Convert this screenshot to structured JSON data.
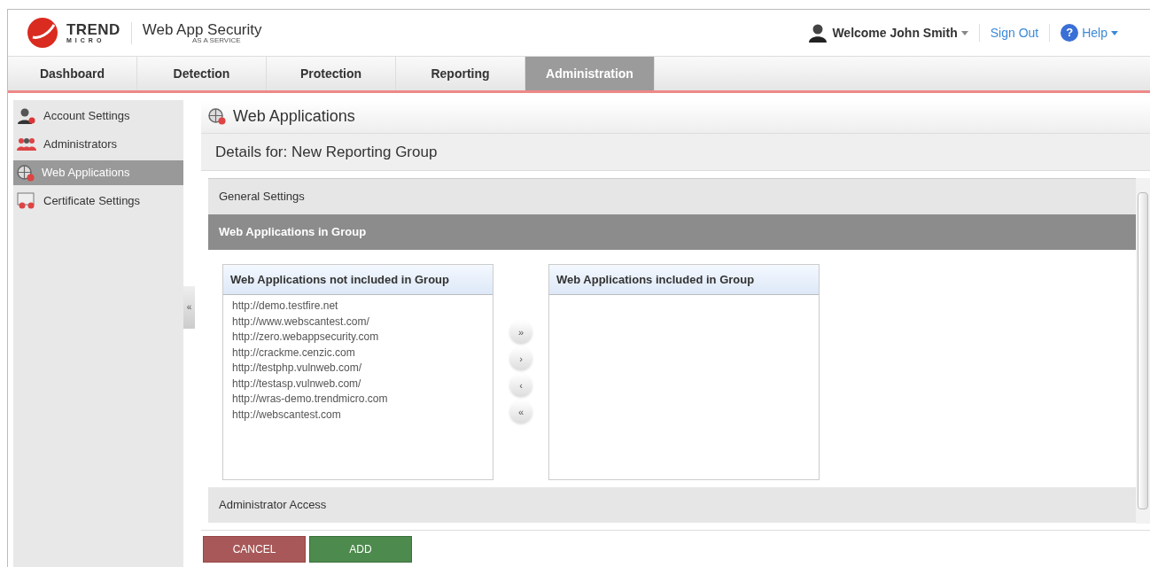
{
  "header": {
    "logo": {
      "word_1": "TREND",
      "word_2": "MICRO"
    },
    "product": "Web App Security",
    "product_sub": "AS A SERVICE",
    "user": "Welcome John Smith",
    "sign_out": "Sign Out",
    "help": "Help",
    "help_icon": "?"
  },
  "tabs": [
    {
      "label": "Dashboard",
      "selected": false
    },
    {
      "label": "Detection",
      "selected": false
    },
    {
      "label": "Protection",
      "selected": false
    },
    {
      "label": "Reporting",
      "selected": false
    },
    {
      "label": "Administration",
      "selected": true
    }
  ],
  "sidebar": {
    "items": [
      {
        "label": "Account Settings",
        "kind": "account",
        "selected": false
      },
      {
        "label": "Administrators",
        "kind": "admins",
        "selected": false
      },
      {
        "label": "Web Applications",
        "kind": "webapps",
        "selected": true
      },
      {
        "label": "Certificate Settings",
        "kind": "certificate",
        "selected": false
      }
    ],
    "collapse": "«"
  },
  "page": {
    "title": "Web Applications",
    "subtitle": "Details for: New Reporting Group"
  },
  "sections": [
    {
      "label": "General Settings",
      "expanded": false
    },
    {
      "label": "Web Applications in Group",
      "expanded": true
    },
    {
      "label": "Administrator Access",
      "expanded": false
    }
  ],
  "lists": {
    "available": {
      "title": "Web Applications not included in Group",
      "items": [
        "http://demo.testfire.net",
        "http://www.webscantest.com/",
        "http://zero.webappsecurity.com",
        "http://crackme.cenzic.com",
        "http://testphp.vulnweb.com/",
        "http://testasp.vulnweb.com/",
        "http://wras-demo.trendmicro.com",
        "http://webscantest.com"
      ]
    },
    "included": {
      "title": "Web Applications included in Group"
    },
    "move_buttons": [
      "»",
      "›",
      "‹",
      "«"
    ]
  },
  "buttons": [
    {
      "label": "CANCEL",
      "kind": "cancel"
    },
    {
      "label": "ADD",
      "kind": "add"
    }
  ]
}
